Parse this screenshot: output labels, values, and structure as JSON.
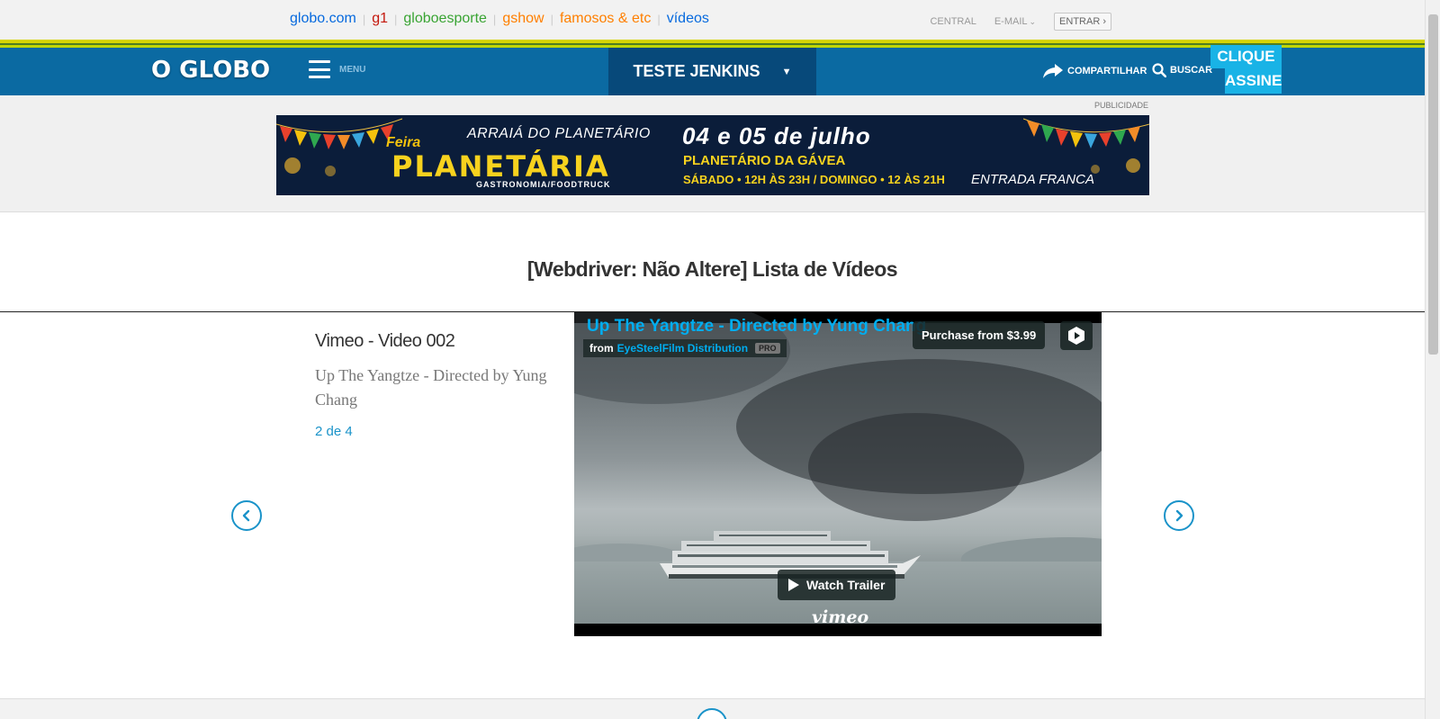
{
  "top_bar": {
    "links": [
      {
        "label": "globo.com",
        "color": "#0669de"
      },
      {
        "label": "g1",
        "color": "#c4170c"
      },
      {
        "label": "globoesporte",
        "color": "#39a433"
      },
      {
        "label": "gshow",
        "color": "#ff7f00"
      },
      {
        "label": "famosos & etc",
        "color": "#ff7f00"
      },
      {
        "label": "vídeos",
        "color": "#0669de"
      }
    ],
    "central": "CENTRAL",
    "email": "E-MAIL",
    "entrar": "ENTRAR ›"
  },
  "header": {
    "logo": "O GLOBO",
    "menu_label": "MENU",
    "section_title": "TESTE JENKINS",
    "section_arrow": "▼",
    "share_label": "COMPARTILHAR",
    "search_label": "BUSCAR",
    "subscribe_line1": "CLIQUE E",
    "subscribe_line2": "ASSINE"
  },
  "ad": {
    "label": "PUBLICIDADE",
    "arraia": "ARRAIÁ DO PLANETÁRIO",
    "feira": "Feira",
    "planetaria": "PLANETÁRIA",
    "gastronomia": "GASTRONOMIA/FOODTRUCK",
    "date": "04 e 05 de julho",
    "place": "PLANETÁRIO DA GÁVEA",
    "schedule": "SÁBADO • 12H ÀS 23H / DOMINGO • 12 ÀS 21H",
    "entrada": "ENTRADA FRANCA"
  },
  "list_title": "[Webdriver: Não Altere] Lista de Vídeos",
  "video": {
    "label": "Vimeo - Video 002",
    "description": "Up The Yangtze - Directed by Yung Chang",
    "position": "2 de 4"
  },
  "player": {
    "title": "Up The Yangtze - Directed by Yung Chang",
    "from": "from",
    "owner": "EyeSteelFilm Distribution",
    "pro_badge": "PRO",
    "purchase": "Purchase from $3.99",
    "watch_trailer": "Watch Trailer",
    "brand": "vimeo"
  }
}
